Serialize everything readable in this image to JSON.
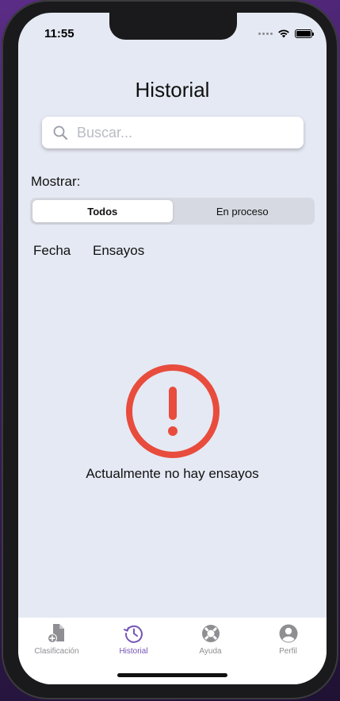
{
  "status_bar": {
    "time": "11:55"
  },
  "header": {
    "title": "Historial"
  },
  "search": {
    "placeholder": "Buscar...",
    "value": ""
  },
  "filter": {
    "label": "Mostrar:",
    "options": [
      "Todos",
      "En proceso"
    ],
    "selected": "Todos"
  },
  "table": {
    "columns": [
      "Fecha",
      "Ensayos"
    ]
  },
  "empty_state": {
    "message": "Actualmente no hay ensayos",
    "icon": "exclamation-circle-icon",
    "color": "#e84c3d"
  },
  "tab_bar": {
    "items": [
      {
        "label": "Clasificación",
        "icon": "document-add-icon"
      },
      {
        "label": "Historial",
        "icon": "history-icon"
      },
      {
        "label": "Ayuda",
        "icon": "lifebuoy-icon"
      },
      {
        "label": "Perfil",
        "icon": "user-circle-icon"
      }
    ],
    "active": "Historial",
    "active_color": "#7454b4",
    "inactive_color": "#8e8e93"
  }
}
